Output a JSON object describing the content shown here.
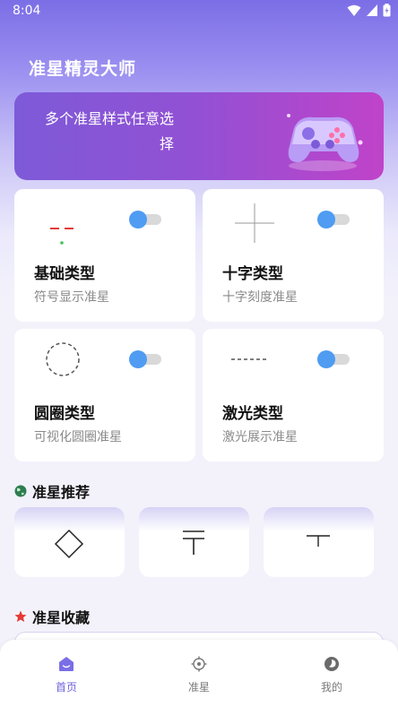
{
  "status_bar": {
    "time": "8:04"
  },
  "app": {
    "title": "准星精灵大师"
  },
  "banner": {
    "text": "多个准星样式任意选择"
  },
  "cards": [
    {
      "title": "基础类型",
      "subtitle": "符号显示准星",
      "enabled": true
    },
    {
      "title": "十字类型",
      "subtitle": "十字刻度准星",
      "enabled": true
    },
    {
      "title": "圆圈类型",
      "subtitle": "可视化圆圈准星",
      "enabled": true
    },
    {
      "title": "激光类型",
      "subtitle": "激光展示准星",
      "enabled": true
    }
  ],
  "recommend": {
    "title": "准星推荐"
  },
  "favorites": {
    "title": "准星收藏"
  },
  "nav": [
    {
      "label": "首页",
      "active": true
    },
    {
      "label": "准星",
      "active": false
    },
    {
      "label": "我的",
      "active": false
    }
  ],
  "colors": {
    "accent": "#6f63de",
    "toggle": "#4f9cf2",
    "banner_start": "#7d5ad8",
    "banner_end": "#c043c9"
  }
}
